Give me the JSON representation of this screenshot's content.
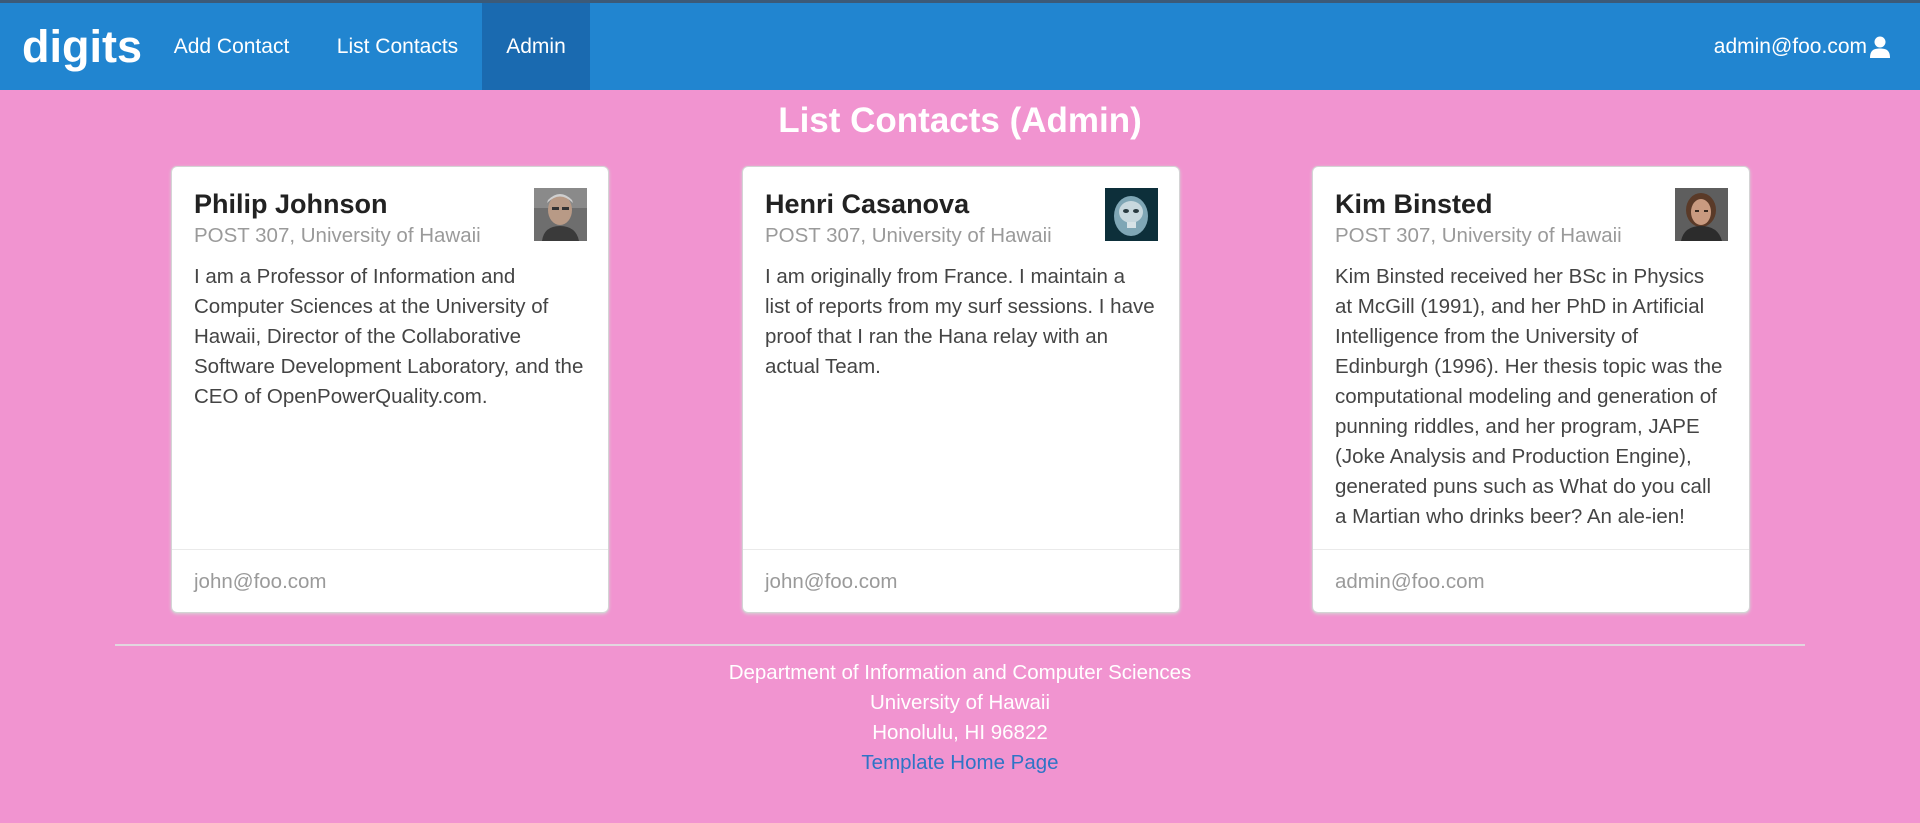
{
  "navbar": {
    "brand": "digits",
    "items": [
      {
        "label": "Add Contact"
      },
      {
        "label": "List Contacts"
      },
      {
        "label": "Admin",
        "active": true
      }
    ],
    "user": "admin@foo.com",
    "user_icon": "user-icon",
    "color": "#2185d0"
  },
  "page": {
    "title": "List Contacts (Admin)",
    "background": "#f194d0"
  },
  "contacts": [
    {
      "name": "Philip Johnson",
      "address": "POST 307, University of Hawaii",
      "description": "I am a Professor of Information and Computer Sciences at the University of Hawaii, Director of the Collaborative Software Development Laboratory, and the CEO of OpenPowerQuality.com.",
      "owner": "john@foo.com"
    },
    {
      "name": "Henri Casanova",
      "address": "POST 307, University of Hawaii",
      "description": "I am originally from France. I maintain a list of reports from my surf sessions. I have proof that I ran the Hana relay with an actual Team.",
      "owner": "john@foo.com"
    },
    {
      "name": "Kim Binsted",
      "address": "POST 307, University of Hawaii",
      "description": "Kim Binsted received her BSc in Physics at McGill (1991), and her PhD in Artificial Intelligence from the University of Edinburgh (1996). Her thesis topic was the computational modeling and generation of punning riddles, and her program, JAPE (Joke Analysis and Production Engine), generated puns such as What do you call a Martian who drinks beer? An ale-ien!",
      "owner": "admin@foo.com"
    }
  ],
  "footer": {
    "line1": "Department of Information and Computer Sciences",
    "line2": "University of Hawaii",
    "line3": "Honolulu, HI 96822",
    "link": "Template Home Page"
  }
}
